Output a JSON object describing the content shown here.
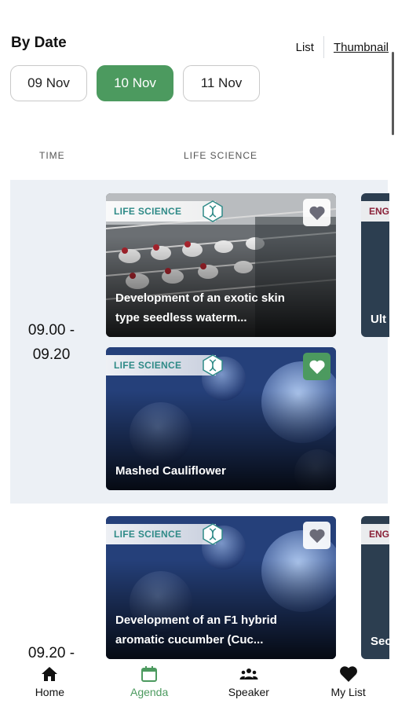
{
  "header": {
    "title": "By Date",
    "view_list": "List",
    "view_thumbnail": "Thumbnail"
  },
  "dates": [
    {
      "label": "09 Nov",
      "active": false
    },
    {
      "label": "10 Nov",
      "active": true
    },
    {
      "label": "11 Nov",
      "active": false
    }
  ],
  "columns": {
    "time": "TIME",
    "category": "LIFE SCIENCE"
  },
  "slots": [
    {
      "time_start": "09.00 -",
      "time_end": "09.20",
      "cards": [
        {
          "tag": "LIFE SCIENCE",
          "caption_line1": "Development of an exotic skin",
          "caption_line2": "type seedless waterm...",
          "favorited": false
        },
        {
          "tag": "LIFE SCIENCE",
          "caption_line1": "Mashed Cauliflower",
          "caption_line2": "",
          "favorited": true
        }
      ],
      "peek": {
        "tag": "ENG",
        "text": "Ult"
      }
    },
    {
      "time_start": "09.20 -",
      "cards": [
        {
          "tag": "LIFE SCIENCE",
          "caption_line1": "Development of an F1 hybrid",
          "caption_line2": "aromatic cucumber (Cuc...",
          "favorited": false
        }
      ],
      "peek": {
        "tag": "ENG",
        "text": "Sec"
      }
    }
  ],
  "nav": [
    {
      "label": "Home",
      "icon": "home-icon",
      "active": false
    },
    {
      "label": "Agenda",
      "icon": "calendar-icon",
      "active": true
    },
    {
      "label": "Speaker",
      "icon": "people-icon",
      "active": false
    },
    {
      "label": "My List",
      "icon": "heart-icon",
      "active": false
    }
  ],
  "colors": {
    "accent": "#4c9a5f",
    "slot_bg": "#ecf0f5",
    "tag_text": "#2e8a87",
    "eng_tag": "#8a2138"
  }
}
